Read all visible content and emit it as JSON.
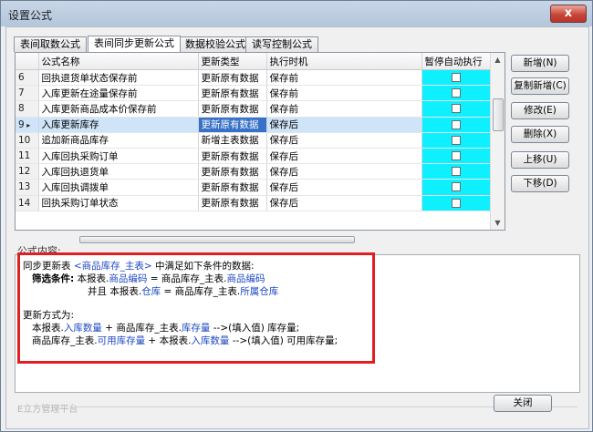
{
  "window": {
    "title": "设置公式",
    "close_glyph": "x"
  },
  "tabs": [
    "表间取数公式",
    "表间同步更新公式",
    "数据校验公式",
    "读写控制公式"
  ],
  "grid": {
    "columns": [
      "公式名称",
      "更新类型",
      "执行时机",
      "暂停自动执行"
    ],
    "rows": [
      {
        "num": "6",
        "name": "回执退货单状态保存前",
        "type": "更新原有数据",
        "timing": "保存前"
      },
      {
        "num": "7",
        "name": "入库更新在途量保存前",
        "type": "更新原有数据",
        "timing": "保存前"
      },
      {
        "num": "8",
        "name": "入库更新商品成本价保存前",
        "type": "更新原有数据",
        "timing": "保存前"
      },
      {
        "num": "9",
        "name": "入库更新库存",
        "type": "更新原有数据",
        "timing": "保存后",
        "selected": true
      },
      {
        "num": "10",
        "name": "追加新商品库存",
        "type": "新增主表数据",
        "timing": "保存后"
      },
      {
        "num": "11",
        "name": "入库回执采购订单",
        "type": "更新原有数据",
        "timing": "保存后"
      },
      {
        "num": "12",
        "name": "入库回执退货单",
        "type": "更新原有数据",
        "timing": "保存后"
      },
      {
        "num": "13",
        "name": "入库回执调拨单",
        "type": "更新原有数据",
        "timing": "保存后"
      },
      {
        "num": "14",
        "name": "回执采购订单状态",
        "type": "更新原有数据",
        "timing": "保存后"
      }
    ]
  },
  "buttons": {
    "add": "新增(N)",
    "copy_add": "复制新增(C)",
    "modify": "修改(E)",
    "delete": "删除(X)",
    "up": "上移(U)",
    "down": "下移(D)",
    "close": "关闭"
  },
  "formula": {
    "label": "公式内容:",
    "l1a": "同步更新表",
    "l1b": "<商品库存_主表>",
    "l1c": "中满足如下条件的数据:",
    "l2a": "筛选条件:",
    "l2b": "本报表.",
    "l2c": "商品编码",
    "l2d": " = 商品库存_主表.",
    "l2e": "商品编码",
    "l3a": "并且 本报表.",
    "l3b": "仓库",
    "l3c": " = 商品库存_主表.",
    "l3d": "所属仓库",
    "l4": "更新方式为:",
    "l5a": "本报表.",
    "l5b": "入库数量",
    "l5c": " + 商品库存_主表.",
    "l5d": "库存量",
    "l5e": " -->(填入值) 库存量;",
    "l6a": "商品库存_主表.",
    "l6b": "可用库存量",
    "l6c": " + 本报表.",
    "l6d": "入库数量",
    "l6e": " -->(填入值) 可用库存量;"
  },
  "footer": {
    "platform": "E立方管理平台"
  }
}
